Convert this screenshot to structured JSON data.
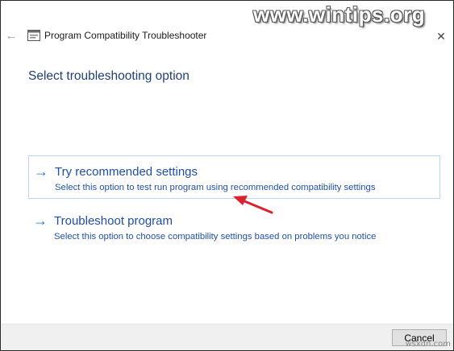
{
  "window": {
    "title": "Program Compatibility Troubleshooter",
    "back_icon": "arrow-left-icon",
    "close_icon": "close-icon"
  },
  "watermark": {
    "text": "www.wintips.org"
  },
  "heading": "Select troubleshooting option",
  "options": [
    {
      "title": "Try recommended settings",
      "description": "Select this option to test run program using recommended compatibility settings",
      "highlighted": true
    },
    {
      "title": "Troubleshoot program",
      "description": "Select this option to choose compatibility settings based on problems you notice",
      "highlighted": false
    }
  ],
  "footer": {
    "cancel_label": "Cancel"
  },
  "corner_logo": {
    "text": "wsxdn.com"
  },
  "colors": {
    "heading": "#1f3f78",
    "link": "#1f4fa0",
    "arrow": "#1a73d0",
    "pointer": "#d9232d"
  }
}
